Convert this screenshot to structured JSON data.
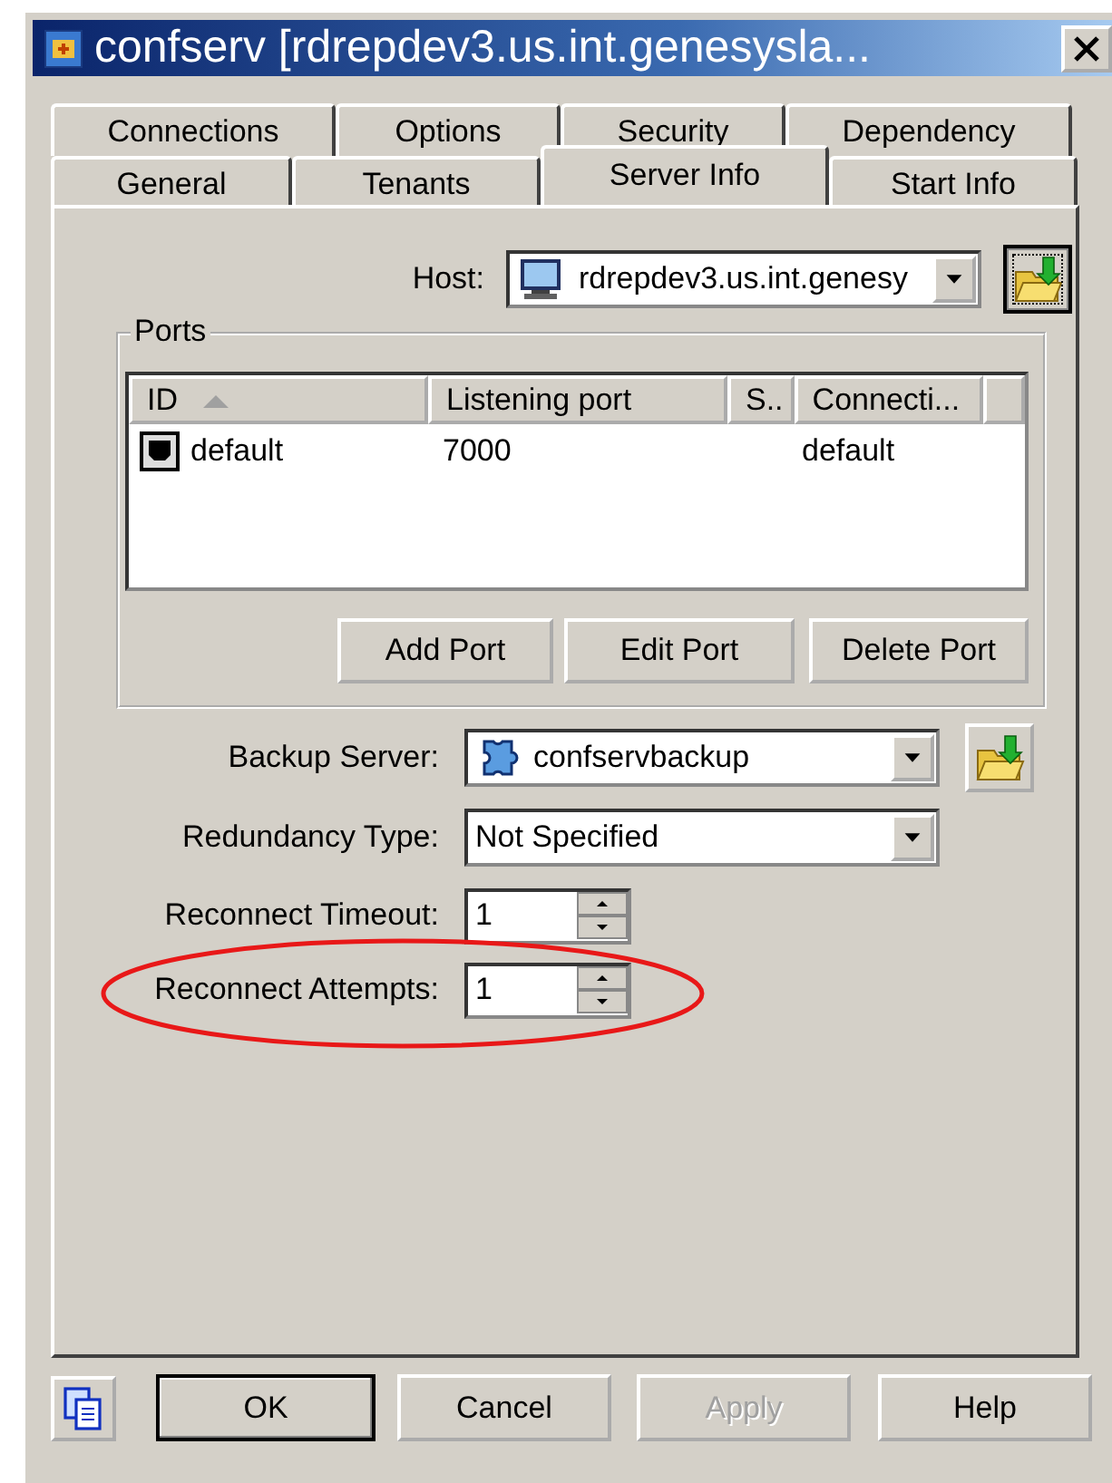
{
  "window": {
    "title": "confserv [rdrepdev3.us.int.genesysla..."
  },
  "tab_rows": [
    {
      "tabs": [
        {
          "label": "Connections",
          "selected": false
        },
        {
          "label": "Options",
          "selected": false
        },
        {
          "label": "Security",
          "selected": false
        },
        {
          "label": "Dependency",
          "selected": false
        }
      ]
    },
    {
      "tabs": [
        {
          "label": "General",
          "selected": false
        },
        {
          "label": "Tenants",
          "selected": false
        },
        {
          "label": "Server Info",
          "selected": true
        },
        {
          "label": "Start Info",
          "selected": false
        }
      ]
    }
  ],
  "host": {
    "label": "Host:",
    "value": "rdrepdev3.us.int.genesy"
  },
  "ports": {
    "title": "Ports",
    "columns": [
      {
        "label": "ID",
        "sorted": true
      },
      {
        "label": "Listening port",
        "sorted": false
      },
      {
        "label": "S..",
        "sorted": false
      },
      {
        "label": "Connecti...",
        "sorted": false
      }
    ],
    "rows": [
      {
        "column_1": "default",
        "column_2": "7000",
        "column_4": "default"
      }
    ],
    "buttons": [
      {
        "label": "Add Port"
      },
      {
        "label": "Edit Port"
      },
      {
        "label": "Delete Port"
      }
    ]
  },
  "fields": [
    {
      "kind": "combo",
      "label": "Backup Server:",
      "value": "confservbackup",
      "browse": true,
      "highlighted": false
    },
    {
      "kind": "combo",
      "label": "Redundancy Type:",
      "value": "Not Specified",
      "browse": false,
      "highlighted": false
    },
    {
      "kind": "spin",
      "label": "Reconnect Timeout:",
      "value": "1",
      "highlighted": false
    },
    {
      "kind": "spin",
      "label": "Reconnect Attempts:",
      "value": "1",
      "highlighted": true
    }
  ],
  "buttons": [
    {
      "label": "OK",
      "default": true,
      "disabled": false
    },
    {
      "label": "Cancel",
      "default": false,
      "disabled": false
    },
    {
      "label": "Apply",
      "default": false,
      "disabled": true
    },
    {
      "label": "Help",
      "default": false,
      "disabled": false
    }
  ]
}
